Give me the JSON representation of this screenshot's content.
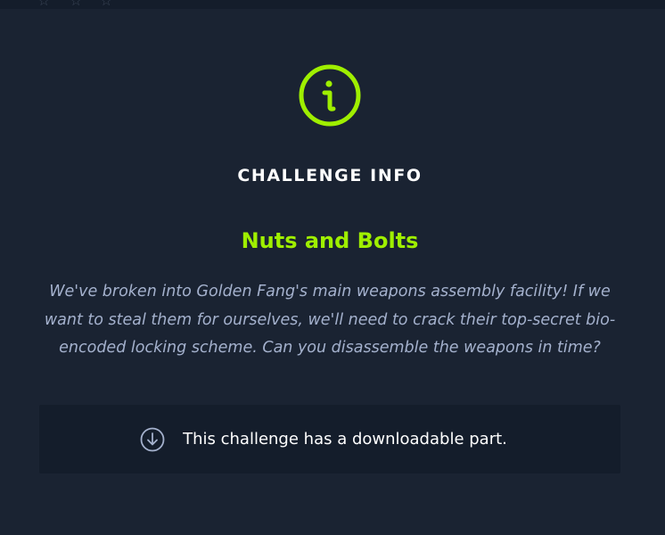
{
  "icons": {
    "info": "info-circle-icon",
    "download": "download-circle-icon",
    "header_stars": "star-icon"
  },
  "colors": {
    "background": "#1a2332",
    "panel": "#141d2b",
    "accent": "#9fef00",
    "heading": "#ffffff",
    "description": "#a4b1cd"
  },
  "modal": {
    "heading": "CHALLENGE INFO",
    "challenge_name": "Nuts and Bolts",
    "description": "We've broken into Golden Fang's main weapons assembly facility! If we want to steal them for ourselves, we'll need to crack their top-secret bio-encoded locking scheme. Can you disassemble the weapons in time?",
    "download_text": "This challenge has a downloadable part."
  }
}
